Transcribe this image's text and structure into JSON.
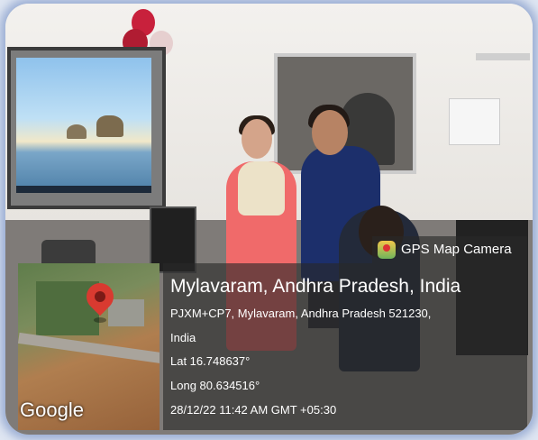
{
  "badge": {
    "label": "GPS Map Camera",
    "icon": "gps-map-camera-icon"
  },
  "map": {
    "attribution": "Google",
    "pin_icon": "location-pin-icon"
  },
  "location": {
    "title": "Mylavaram, Andhra Pradesh, India",
    "address_line1": "PJXM+CP7, Mylavaram, Andhra Pradesh 521230,",
    "address_line2": "India",
    "latitude": "Lat 16.748637°",
    "longitude": "Long 80.634516°",
    "timestamp": "28/12/22 11:42 AM GMT +05:30"
  },
  "colors": {
    "overlay": "#282828",
    "pin": "#d93a30",
    "frame_glow": "#96aad2"
  }
}
